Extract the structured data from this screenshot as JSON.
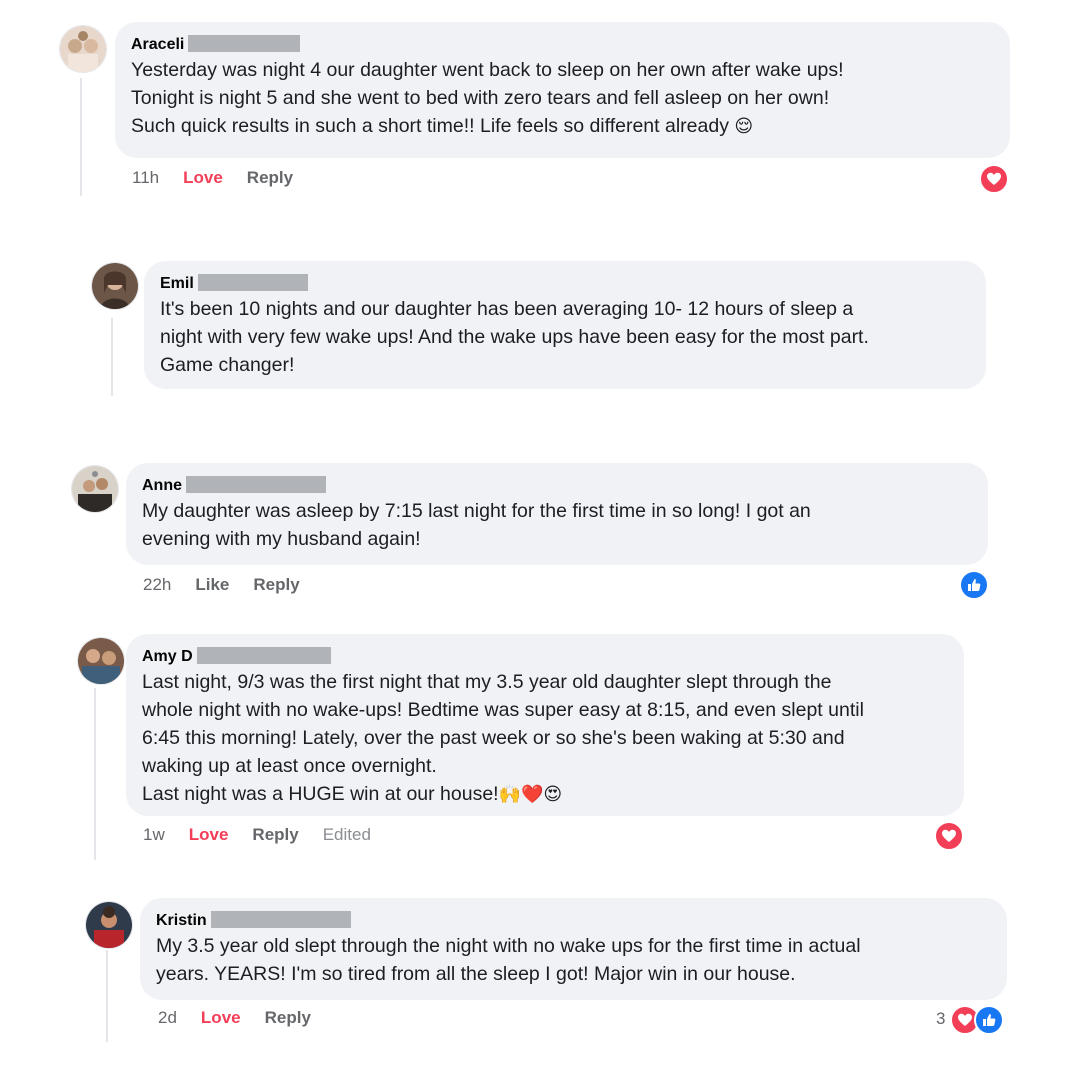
{
  "comments": [
    {
      "name": "Araceli",
      "text": "Yesterday was night 4 our daughter went back to sleep on her own after wake ups!\nTonight is night 5 and she went to bed with zero tears and fell asleep on her own!\nSuch quick results in such a short time!! Life feels so different already",
      "emoji": "😌",
      "time": "11h",
      "action": "Love",
      "reply": "Reply",
      "reaction": "heart-icon"
    },
    {
      "name": "Emil",
      "text": "It's been 10 nights and our daughter has been averaging 10- 12 hours of sleep a\nnight with very few wake ups! And the wake ups have been easy for the most part.\nGame changer!"
    },
    {
      "name": "Anne",
      "text": "My daughter was asleep by 7:15 last night for the first time in so long! I got an\nevening with my husband again!",
      "time": "22h",
      "action": "Like",
      "reply": "Reply",
      "reaction": "thumbs-up-icon"
    },
    {
      "name": "Amy D",
      "text": "Last night, 9/3 was the first night that my 3.5 year old daughter slept through the\nwhole night with no wake-ups! Bedtime was super easy at 8:15, and even slept until\n6:45 this morning! Lately, over the past week or so she's been waking at 5:30 and\nwaking up at least once overnight.\nLast night was a HUGE win at our house!",
      "emoji": "🙌❤️😍",
      "time": "1w",
      "action": "Love",
      "reply": "Reply",
      "edited": "Edited",
      "reaction": "heart-icon"
    },
    {
      "name": "Kristin",
      "text": "My 3.5 year old slept through the night with no wake ups for the first time in actual\nyears. YEARS! I'm so tired from all the sleep I got! Major win in our house.",
      "time": "2d",
      "action": "Love",
      "reply": "Reply",
      "reaction_count": "3",
      "reactions": [
        "heart-icon",
        "thumbs-up-icon"
      ]
    }
  ],
  "colors": {
    "bubble": "#f0f2f5",
    "love": "#f33e58",
    "like": "#1877f2",
    "meta": "#65676b",
    "redaction": "#b0b3b8"
  }
}
